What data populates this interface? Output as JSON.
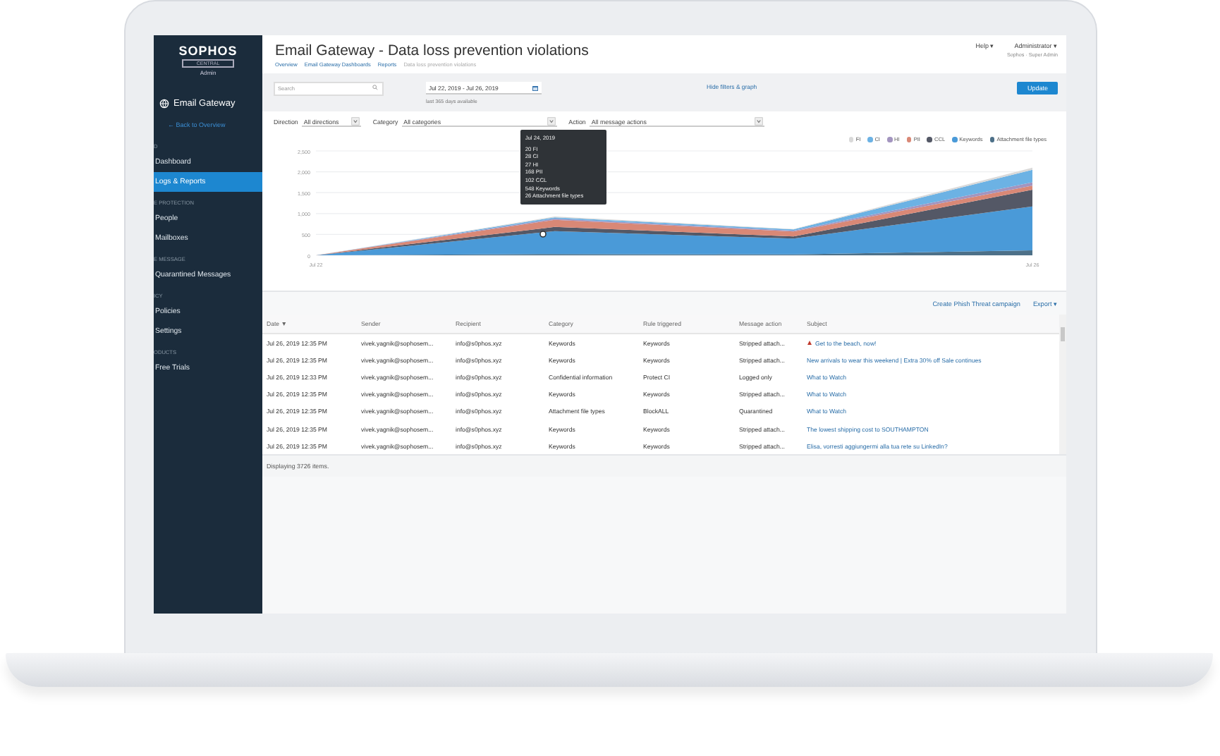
{
  "sidebar": {
    "logo": "SOPHOS",
    "logo_sub": "CENTRAL",
    "role": "Admin",
    "product": "Email Gateway",
    "back": "← Back to Overview",
    "sections": [
      {
        "heading": "D",
        "items": [
          {
            "label": "Dashboard",
            "selected": false
          },
          {
            "label": "Logs & Reports",
            "selected": true
          }
        ]
      },
      {
        "heading": "E PROTECTION",
        "items": [
          {
            "label": "People",
            "selected": false
          },
          {
            "label": "Mailboxes",
            "selected": false
          }
        ]
      },
      {
        "heading": "E MESSAGE",
        "items": [
          {
            "label": "Quarantined Messages",
            "selected": false
          }
        ]
      },
      {
        "heading": "ICY",
        "items": [
          {
            "label": "Policies",
            "selected": false
          },
          {
            "label": "Settings",
            "selected": false
          }
        ]
      },
      {
        "heading": "ODUCTS",
        "items": [
          {
            "label": "Free Trials",
            "selected": false
          }
        ]
      }
    ]
  },
  "header": {
    "title": "Email Gateway - Data loss prevention violations",
    "breadcrumbs": [
      "Overview",
      "Email Gateway Dashboards",
      "Reports",
      "Data loss prevention violations"
    ],
    "help": "Help ▾",
    "user": "Administrator ▾",
    "user_sub": "Sophos · Super Admin"
  },
  "filters": {
    "search": {
      "placeholder": "Search"
    },
    "date": "Jul 22, 2019 - Jul 26, 2019",
    "date_hint": "last 365 days available",
    "toggle_link": "Hide filters & graph",
    "update": "Update",
    "selects": [
      {
        "label": "Direction",
        "value": "All directions"
      },
      {
        "label": "Category",
        "value": "All categories"
      },
      {
        "label": "Action",
        "value": "All message actions"
      }
    ]
  },
  "chart": {
    "chart_data": {
      "type": "area",
      "stacked": true,
      "grid": true,
      "categories": [
        "Jul 22",
        null,
        null,
        "Jul 26"
      ],
      "ylim": [
        0,
        2500
      ],
      "yticks": [
        {
          "value": 0,
          "label": "0"
        },
        {
          "value": 500,
          "label": "500"
        },
        {
          "value": 1000,
          "label": "1,000"
        },
        {
          "value": 1500,
          "label": "1,500"
        },
        {
          "value": 2000,
          "label": "2,000"
        },
        {
          "value": 2500,
          "label": "2,500"
        }
      ],
      "series": [
        {
          "name": "FI",
          "color": "#d9d9d9",
          "values": [
            0,
            20,
            10,
            50
          ]
        },
        {
          "name": "CI",
          "color": "#6cb2e4",
          "values": [
            0,
            30,
            30,
            300
          ]
        },
        {
          "name": "HI",
          "color": "#a395bf",
          "values": [
            0,
            30,
            20,
            80
          ]
        },
        {
          "name": "PII",
          "color": "#d98876",
          "values": [
            0,
            170,
            120,
            100
          ]
        },
        {
          "name": "CCL",
          "color": "#545866",
          "values": [
            0,
            100,
            50,
            400
          ]
        },
        {
          "name": "Keywords",
          "color": "#4a9ad8",
          "values": [
            0,
            550,
            380,
            1050
          ]
        },
        {
          "name": "Attachment file types",
          "color": "#4d7088",
          "values": [
            0,
            30,
            20,
            120
          ]
        }
      ]
    },
    "tooltip": {
      "title": "Jul 24, 2019",
      "lines": [
        "20 FI",
        "28 CI",
        "27 HI",
        "168 PII",
        "102 CCL",
        "548 Keywords",
        "26 Attachment file types"
      ]
    }
  },
  "table": {
    "actions": [
      "Create Phish Threat campaign",
      "Export ▾"
    ],
    "columns": [
      "Date ▼",
      "Sender",
      "Recipient",
      "Category",
      "Rule triggered",
      "Message action",
      "Subject"
    ],
    "rows": [
      {
        "cells": [
          "Jul 26, 2019 12:35 PM",
          "vivek.yagnik@sophosem...",
          "info@s0phos.xyz",
          "Keywords",
          "Keywords",
          "Stripped attach...",
          "Get to the beach, now!"
        ],
        "flagged": true
      },
      {
        "cells": [
          "Jul 26, 2019 12:35 PM",
          "vivek.yagnik@sophosem...",
          "info@s0phos.xyz",
          "Keywords",
          "Keywords",
          "Stripped attach...",
          "New arrivals to wear this weekend | Extra 30% off Sale continues"
        ],
        "flagged": false
      },
      {
        "cells": [
          "Jul 26, 2019 12:33 PM",
          "vivek.yagnik@sophosem...",
          "info@s0phos.xyz",
          "Confidential information",
          "Protect CI",
          "Logged only",
          "What to Watch"
        ],
        "flagged": false
      },
      {
        "cells": [
          "Jul 26, 2019 12:35 PM",
          "vivek.yagnik@sophosem...",
          "info@s0phos.xyz",
          "Keywords",
          "Keywords",
          "Stripped attach...",
          "What to Watch"
        ],
        "flagged": false
      },
      {
        "cells": [
          "Jul 26, 2019 12:35 PM",
          "vivek.yagnik@sophosem...",
          "info@s0phos.xyz",
          "Attachment file types",
          "BlockALL",
          "Quarantined",
          "What to Watch"
        ],
        "flagged": false
      },
      {
        "cells": [
          "Jul 26, 2019 12:35 PM",
          "vivek.yagnik@sophosem...",
          "info@s0phos.xyz",
          "Keywords",
          "Keywords",
          "Stripped attach...",
          "The lowest shipping cost to SOUTHAMPTON"
        ],
        "flagged": false
      },
      {
        "cells": [
          "Jul 26, 2019 12:35 PM",
          "vivek.yagnik@sophosem...",
          "info@s0phos.xyz",
          "Keywords",
          "Keywords",
          "Stripped attach...",
          "Elisa, vorresti aggiungermi alla tua rete su LinkedIn?"
        ],
        "flagged": false
      }
    ],
    "footer": "Displaying 3726 items."
  }
}
